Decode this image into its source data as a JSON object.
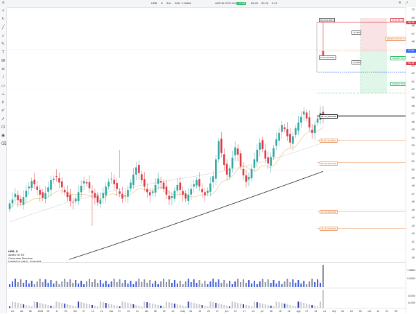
{
  "toolbar": {
    "symbol": "HRB",
    "interval": "D",
    "size": "30d",
    "volume_label": "30M",
    "volume_value": "1.588M",
    "company": "H&R BLOCK INC.",
    "status_badge": "+0.08",
    "price_a": "68.43",
    "price_b": "63.26",
    "time": "9:15"
  },
  "price_axis": [
    "70",
    "69",
    "68",
    "67",
    "66",
    "65",
    "64",
    "63",
    "62",
    "61",
    "60",
    "59",
    "58",
    "57",
    "56",
    "55",
    "54",
    "53",
    "52",
    "51",
    "50",
    "49",
    "48",
    "47",
    "46",
    "45",
    "44",
    "43",
    "42",
    "41",
    "40",
    "39"
  ],
  "price_boxes": [
    {
      "text": "68.43",
      "color": "#e0424e"
    },
    {
      "text": "64.85",
      "color": "#2962ff"
    },
    {
      "text": "63.26",
      "color": "#e0424e"
    }
  ],
  "symbol_info": {
    "title": "HRB, D",
    "exchange": "Aktien NYSE",
    "sector": "Consumer Services",
    "indicator": "ProRealTime Trading · Tomas Bulat"
  },
  "position_tool": {
    "stop": "STOP 68.96",
    "entry": "ENTRY 2,979  61.73",
    "target1": "TARGET 63.48",
    "target2": "TARGET 59.80",
    "top_label": "68.43 (0.00%)",
    "mid_label": "64.23 (33.05%)",
    "pct_a": "+4.28%",
    "pct_b": "+5.28%"
  },
  "fib_levels": [
    {
      "label": "56.73 (100.00%)",
      "value": 56.73,
      "color": "#000000"
    },
    {
      "label": "54.81 (111.80%)",
      "value": 53.7,
      "color": "#f0a070"
    },
    {
      "label": "50.93 (160.00%)",
      "value": 50.9,
      "color": "#f0a070"
    },
    {
      "label": "44.14 (200.00%)",
      "value": 44.8,
      "color": "#f0a070"
    },
    {
      "label": "42.11 (220.00%)",
      "value": 42.7,
      "color": "#f0a070"
    }
  ],
  "x_axis": [
    "24",
    "dic",
    "08",
    "2024",
    "09",
    "17",
    "23",
    "feb",
    "07",
    "14",
    "21",
    "mar",
    "07",
    "14",
    "21",
    "abr",
    "08",
    "15",
    "22",
    "may",
    "06",
    "13",
    "20",
    "27",
    "jun",
    "10",
    "17",
    "24",
    "jul",
    "08",
    "15",
    "22",
    "ago",
    "07",
    "14",
    "21",
    "sep",
    "16",
    "23",
    "30",
    "oct",
    "14",
    "21",
    "28"
  ],
  "volume_pane": {
    "label": "Volume",
    "value_a": "1.588M",
    "value_b": "5.000M"
  },
  "lower_pane": {
    "value_a": "15,000",
    "value_b": "10,000"
  },
  "colors": {
    "bull": "#2fa8a0",
    "bear": "#e03a46",
    "ma_long": "#222222",
    "ma_short": "#e8c070"
  },
  "chart_data": {
    "type": "candlestick",
    "close": [
      45.8,
      46.3,
      47.0,
      46.2,
      45.9,
      46.6,
      47.4,
      47.9,
      48.6,
      48.2,
      47.5,
      46.9,
      46.5,
      47.1,
      47.8,
      48.7,
      48.9,
      49.1,
      48.4,
      47.8,
      47.2,
      46.6,
      46.1,
      45.9,
      46.4,
      47.2,
      48.0,
      48.6,
      48.3,
      47.7,
      47.1,
      46.5,
      45.9,
      46.3,
      47.1,
      47.9,
      48.5,
      48.9,
      48.2,
      47.6,
      47.0,
      46.4,
      46.8,
      47.5,
      48.4,
      49.4,
      50.3,
      49.6,
      48.7,
      47.9,
      47.2,
      46.8,
      47.3,
      48.1,
      48.9,
      48.4,
      47.6,
      46.9,
      46.3,
      46.7,
      47.4,
      48.1,
      47.5,
      46.9,
      46.4,
      46.9,
      47.6,
      48.2,
      48.7,
      47.9,
      47.2,
      46.8,
      47.4,
      48.3,
      49.2,
      51.3,
      53.6,
      52.1,
      50.6,
      49.4,
      50.2,
      51.5,
      52.8,
      51.9,
      50.4,
      49.3,
      48.5,
      49.1,
      50.1,
      51.3,
      52.5,
      53.4,
      52.6,
      51.4,
      50.8,
      51.6,
      52.7,
      53.8,
      54.6,
      55.6,
      55.1,
      54.2,
      53.4,
      54.2,
      55.2,
      55.9,
      56.6,
      57.3,
      56.4,
      55.3,
      54.6,
      55.6,
      56.4,
      57.1,
      56.5
    ]
  }
}
